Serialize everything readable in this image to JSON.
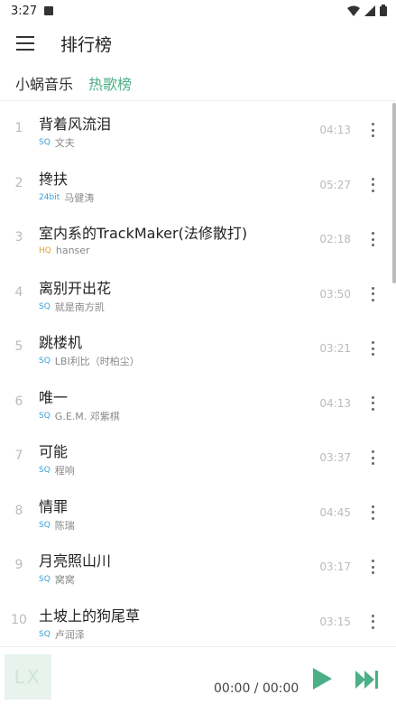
{
  "status": {
    "time": "3:27"
  },
  "header": {
    "title": "排行榜"
  },
  "tabs": [
    {
      "label": "小蜗音乐",
      "active": false
    },
    {
      "label": "热歌榜",
      "active": true
    }
  ],
  "songs": [
    {
      "num": "1",
      "title": "背着风流泪",
      "quality": "SQ",
      "artist": "文夫",
      "duration": "04:13"
    },
    {
      "num": "2",
      "title": "搀扶",
      "quality": "24bit",
      "artist": "马健涛",
      "duration": "05:27"
    },
    {
      "num": "3",
      "title": "室内系的TrackMaker(法修散打)",
      "quality": "HQ",
      "artist": "hanser",
      "duration": "02:18"
    },
    {
      "num": "4",
      "title": "离别开出花",
      "quality": "SQ",
      "artist": "就是南方凯",
      "duration": "03:50"
    },
    {
      "num": "5",
      "title": "跳楼机",
      "quality": "SQ",
      "artist": "LBI利比（时柏尘）",
      "duration": "03:21"
    },
    {
      "num": "6",
      "title": "唯一",
      "quality": "SQ",
      "artist": "G.E.M. 邓紫棋",
      "duration": "04:13"
    },
    {
      "num": "7",
      "title": "可能",
      "quality": "SQ",
      "artist": "程响",
      "duration": "03:37"
    },
    {
      "num": "8",
      "title": "情罪",
      "quality": "SQ",
      "artist": "陈瑞",
      "duration": "04:45"
    },
    {
      "num": "9",
      "title": "月亮照山川",
      "quality": "SQ",
      "artist": "窝窝",
      "duration": "03:17"
    },
    {
      "num": "10",
      "title": "土坡上的狗尾草",
      "quality": "SQ",
      "artist": "卢润泽",
      "duration": "03:15"
    }
  ],
  "colors": {
    "accent": "#4caf87",
    "sq": "#3a9fd6",
    "hq": "#e0a030",
    "bit24": "#3a9fd6"
  },
  "player": {
    "cover_text": "LX",
    "time": "00:00 / 00:00"
  },
  "icons": {
    "menu": "menu-icon",
    "more": "more-vert-icon",
    "play": "play-icon",
    "next": "skip-next-icon"
  }
}
